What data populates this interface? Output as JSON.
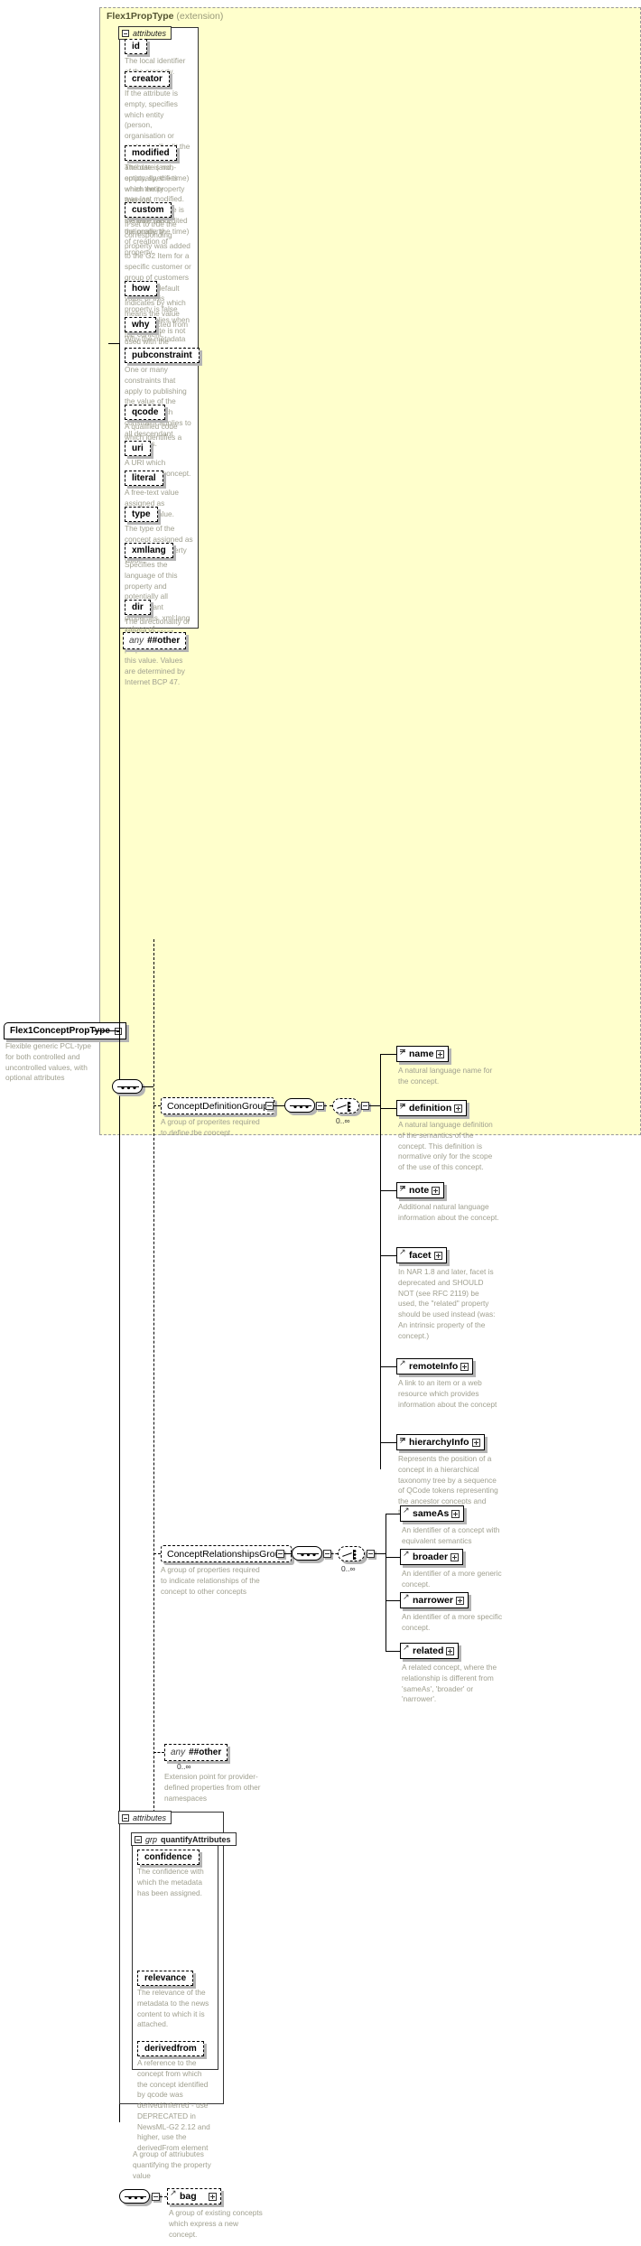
{
  "diagram": {
    "kind": "xml-schema-documentation",
    "extension_panel": {
      "title": "Flex1PropType",
      "subtitle": "(extension)"
    },
    "root_type": {
      "name": "Flex1ConceptPropType",
      "description": "Flexible generic PCL-type for both controlled and uncontrolled values, with optional attributes"
    },
    "attributes_label": "attributes",
    "group_label": "grp",
    "cardinality_unbounded": "0..∞",
    "wildcard": {
      "keyword": "any",
      "namespace": "##other"
    },
    "top_attributes": [
      {
        "name": "id",
        "desc": "The local identifier of the property."
      },
      {
        "name": "creator",
        "desc": "If the attribute is empty, specifies which entity (person, organisation or system) will edit the property. If the attribute is non-empty, specifies which entity (person, organisation or system) has edited the property."
      },
      {
        "name": "modified",
        "desc": "The date (and, optionally, the time) when the property was last modified. The initial value is the date (and, optionally, the time) of creation of property."
      },
      {
        "name": "custom",
        "desc": "If set to true the corresponding property was added to the G2 Item for a specific customer or group of customers only. The default value of this property is false which applies when this attribute is not used with the property."
      },
      {
        "name": "how",
        "desc": "Indicates by which means the value was extracted from the content."
      },
      {
        "name": "why",
        "desc": "Why the metadata has been included."
      },
      {
        "name": "pubconstraint",
        "desc": "One or many constraints that apply to publishing the value of the property. Each constraint applies to all descendant elements."
      },
      {
        "name": "qcode",
        "desc": "A qualified code which identifies a concept."
      },
      {
        "name": "uri",
        "desc": "A URI which identifies a concept."
      },
      {
        "name": "literal",
        "desc": "A free-text value assigned as property value."
      },
      {
        "name": "type",
        "desc": "The type of the concept assigned as controlled property value."
      },
      {
        "name": "xmllang",
        "desc": "Specifies the language of this property and potentially all descendant properties. xml:lang values of descendant properties override this value. Values are determined by Internet BCP 47."
      },
      {
        "name": "dir",
        "desc": "The directionality of textual content."
      }
    ],
    "concept_definition_group": {
      "name": "ConceptDefinitionGroup",
      "desc": "A group of properites required to define the concept",
      "elements": [
        {
          "name": "name",
          "desc": "A natural language name for the concept."
        },
        {
          "name": "definition",
          "desc": "A natural language definition of the semantics of the concept. This definition is normative only for the scope of the use of this concept."
        },
        {
          "name": "note",
          "desc": "Additional natural language information about the concept."
        },
        {
          "name": "facet",
          "desc": "In NAR 1.8 and later, facet is deprecated and SHOULD NOT (see RFC 2119) be used, the \"related\" property should be used instead (was: An intrinsic property of the concept.)"
        },
        {
          "name": "remoteInfo",
          "desc": "A link to an item or a web resource which provides information about the concept"
        },
        {
          "name": "hierarchyInfo",
          "desc": "Represents the position of a concept in a hierarchical taxonomy tree by a sequence of QCode tokens representing the ancestor concepts and this concept"
        }
      ]
    },
    "concept_relationships_group": {
      "name": "ConceptRelationshipsGroup",
      "desc": "A group of properties required to indicate relationships of the concept to other concepts",
      "elements": [
        {
          "name": "sameAs",
          "desc": "An identifier of a concept with equivalent semantics"
        },
        {
          "name": "broader",
          "desc": "An identifier of a more generic concept."
        },
        {
          "name": "narrower",
          "desc": "An identifier of a more specific concept."
        },
        {
          "name": "related",
          "desc": "A related concept, where the relationship is different from 'sameAs', 'broader' or 'narrower'."
        }
      ]
    },
    "extension_point": {
      "desc": "Extension point for provider-defined properties from other namespaces"
    },
    "quantify_attributes": {
      "group_name": "quantifyAttributes",
      "desc": "A group of attriubutes quantifying the property value",
      "attributes": [
        {
          "name": "confidence",
          "desc": "The confidence with which the metadata has been assigned."
        },
        {
          "name": "relevance",
          "desc": "The relevance of the metadata to the news content to which it is attached."
        },
        {
          "name": "derivedfrom",
          "desc": "A reference to the concept from which the concept identified by qcode was derived/inferred - use DEPRECATED in NewsML-G2 2.12 and higher, use the derivedFrom element"
        }
      ]
    },
    "bag_element": {
      "name": "bag",
      "desc": "A group of existing concepts which express a new concept."
    },
    "colors": {
      "panel_bg": "#ffffcc",
      "node_bg": "#ffffff",
      "desc_text": "#a0a090",
      "line": "#000000",
      "shadow": "#b4b4b4"
    }
  }
}
